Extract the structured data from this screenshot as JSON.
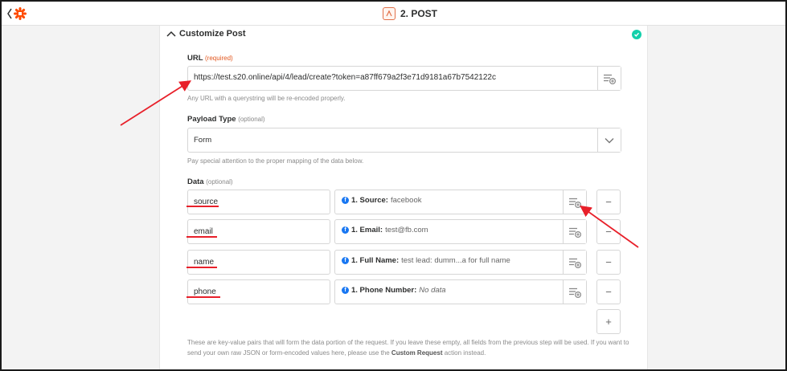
{
  "header": {
    "step_title": "2. POST"
  },
  "section": {
    "title": "Customize Post"
  },
  "url_field": {
    "label": "URL",
    "required_tag": "(required)",
    "value": "https://test.s20.online/api/4/lead/create?token=a87ff679a2f3e71d9181a67b7542122c",
    "help": "Any URL with a querystring will be re-encoded properly."
  },
  "payload_type": {
    "label": "Payload Type",
    "optional_tag": "(optional)",
    "value": "Form",
    "help": "Pay special attention to the proper mapping of the data below."
  },
  "data_field": {
    "label": "Data",
    "optional_tag": "(optional)",
    "rows": [
      {
        "key": "source",
        "pill_key": "1. Source:",
        "pill_value": "facebook"
      },
      {
        "key": "email",
        "pill_key": "1. Email:",
        "pill_value": "test@fb.com"
      },
      {
        "key": "name",
        "pill_key": "1. Full Name:",
        "pill_value": "test lead: dumm...a for full name"
      },
      {
        "key": "phone",
        "pill_key": "1. Phone Number:",
        "pill_value": "No data"
      }
    ],
    "remove_label": "−",
    "add_label": "+",
    "fb_glyph": "f"
  },
  "footer": {
    "help_part1": "These are key-value pairs that will form the data portion of the request. If you leave these empty, all fields from the previous step will be used. If you want to send your own raw JSON or form-encoded values here, please use the",
    "help_link": "Custom Request",
    "help_part2": "action instead."
  },
  "colors": {
    "brand_orange": "#ff4a00",
    "success": "#13d0ab",
    "annotation_red": "#e8202a",
    "facebook_blue": "#1877f2"
  },
  "icons": {
    "back": "chevron-left-icon",
    "logo": "zapier-asterisk-icon",
    "step": "webhook-icon",
    "collapse": "chevron-up-icon",
    "complete": "check-circle-icon",
    "insert_data": "insert-data-icon",
    "dropdown": "chevron-down-icon",
    "facebook": "facebook-icon"
  }
}
